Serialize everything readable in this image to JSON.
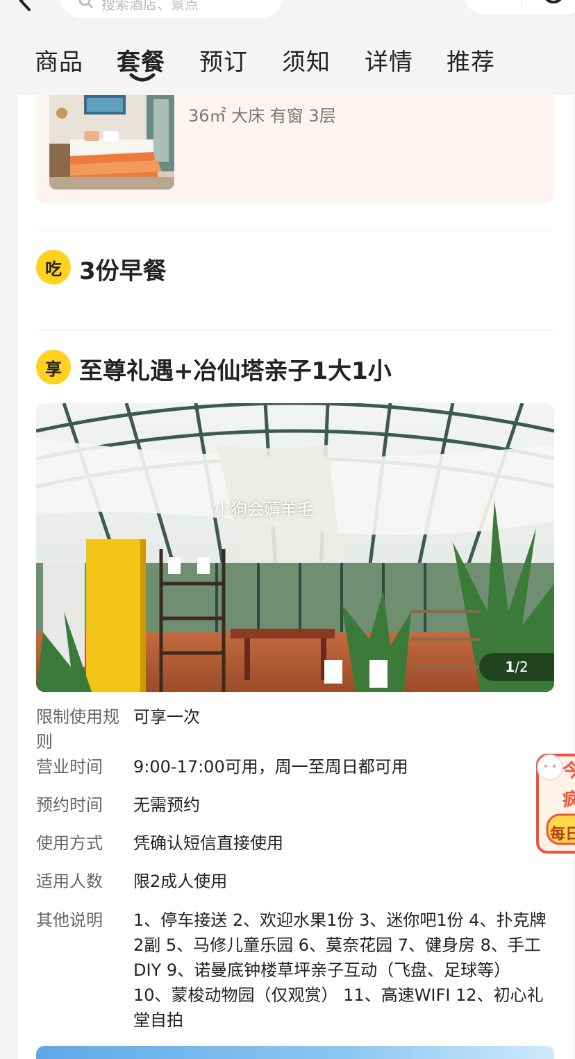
{
  "header": {
    "search_placeholder": "搜索酒店、景点",
    "tabs": [
      {
        "label": "商品",
        "active": false
      },
      {
        "label": "套餐",
        "active": true
      },
      {
        "label": "预订",
        "active": false
      },
      {
        "label": "须知",
        "active": false
      },
      {
        "label": "详情",
        "active": false
      },
      {
        "label": "推荐",
        "active": false
      }
    ]
  },
  "room": {
    "attrs": "36㎡  大床  有窗  3层"
  },
  "sections": [
    {
      "badge": "吃",
      "title": "3份早餐"
    },
    {
      "badge": "享",
      "title": "至尊礼遇+冶仙塔亲子1大1小"
    }
  ],
  "photo": {
    "caption": "小狗会薅羊毛",
    "counter_current": "1",
    "counter_total": "/2"
  },
  "details": [
    {
      "label": "限制使用规则",
      "value": "可享一次"
    },
    {
      "label": "营业时间",
      "value": "9:00-17:00可用，周一至周日都可用"
    },
    {
      "label": "预约时间",
      "value": "无需预约"
    },
    {
      "label": "使用方式",
      "value": "凭确认短信直接使用"
    },
    {
      "label": "适用人数",
      "value": "限2成人使用"
    },
    {
      "label": "其他说明",
      "value": "1、停车接送 2、欢迎水果1份 3、迷你吧1份 4、扑克牌2副 5、马修儿童乐园 6、莫奈花园 7、健身房 8、手工DIY 9、诺曼底钟楼草坪亲子互动（飞盘、足球等） 10、蒙梭动物园（仅观赏） 11、高速WIFI 12、初心礼堂自拍"
    }
  ],
  "promo": {
    "text_top": "今",
    "text_mid": "疯",
    "text_bottom": "每日"
  },
  "colors": {
    "accent_yellow": "#ffd21f",
    "room_card_bg": "#fdf3f1",
    "promo_red": "#f0533a"
  }
}
